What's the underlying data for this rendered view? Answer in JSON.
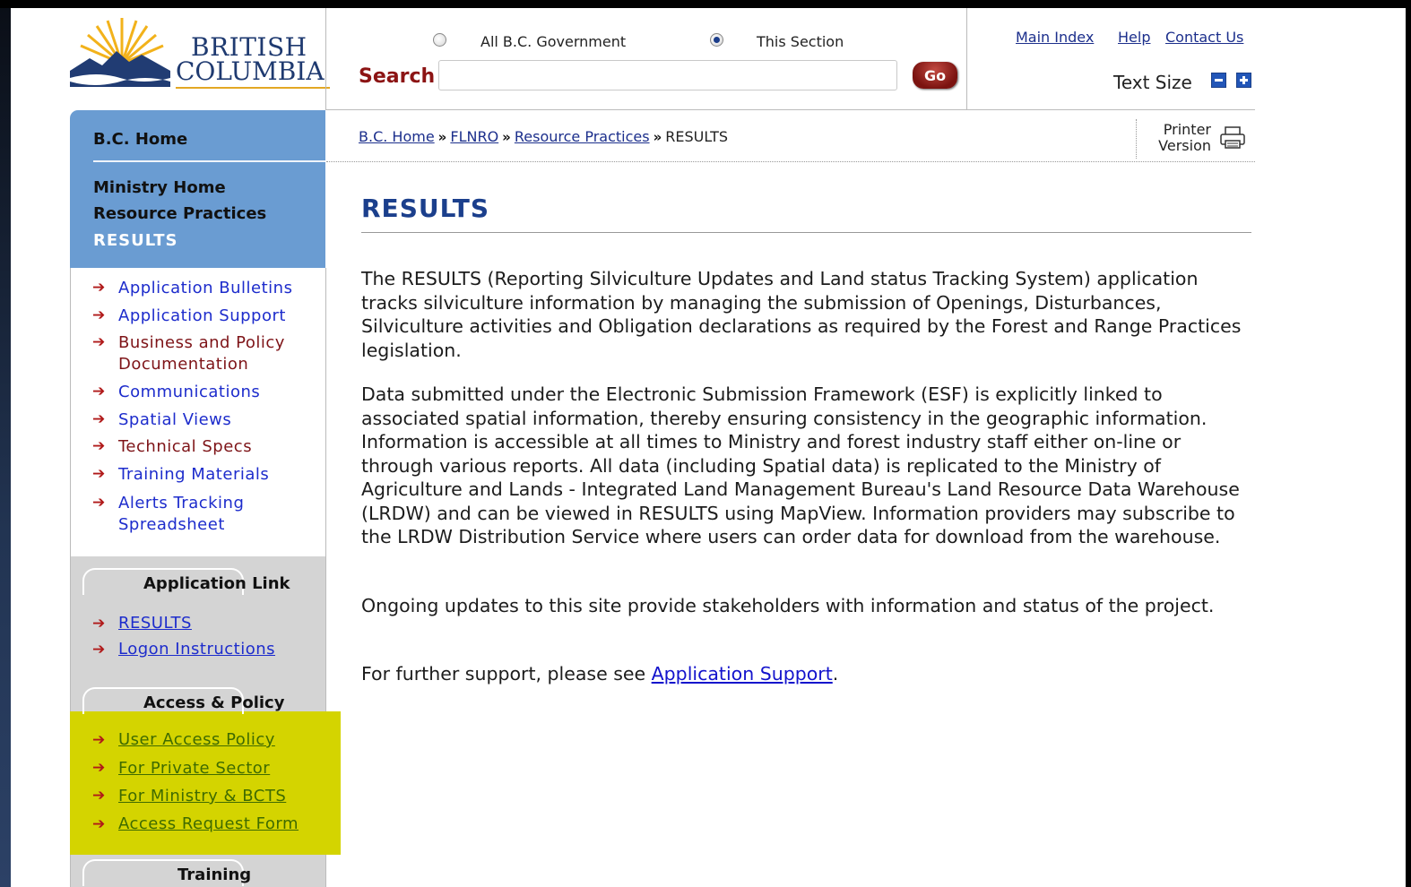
{
  "header": {
    "logo_line1": "BRITISH",
    "logo_line2": "COLUMBIA",
    "scope_options": [
      "All B.C. Government",
      "This Section"
    ],
    "scope_selected": "This Section",
    "search_label": "Search",
    "search_value": "",
    "go_label": "Go",
    "top_links": [
      "Main Index",
      "Help",
      "Contact Us"
    ],
    "text_size_label": "Text Size"
  },
  "nav": {
    "home": "B.C. Home",
    "ministry_home": "Ministry Home",
    "resource_practices": "Resource Practices",
    "current": "RESULTS",
    "links": [
      {
        "label": "Application Bulletins"
      },
      {
        "label": "Application Support"
      },
      {
        "label_line1": "Business and Policy",
        "label_line2": "Documentation"
      },
      {
        "label": "Communications"
      },
      {
        "label": "Spatial Views"
      },
      {
        "label": "Technical Specs"
      },
      {
        "label": "Training Materials"
      },
      {
        "label_line1": "Alerts Tracking",
        "label_line2": "Spreadsheet"
      }
    ],
    "application_link": {
      "title": "Application Link",
      "links": [
        "RESULTS",
        "Logon Instructions"
      ]
    },
    "access_policy": {
      "title": "Access & Policy",
      "links": [
        "User Access Policy",
        "For Private Sector",
        "For Ministry & BCTS",
        "Access Request Form"
      ]
    },
    "training": {
      "title": "Training"
    }
  },
  "breadcrumb": {
    "items": [
      "B.C. Home",
      "FLNRO",
      "Resource Practices"
    ],
    "current": "RESULTS",
    "separator": "»"
  },
  "printer": {
    "line1": "Printer",
    "line2": "Version"
  },
  "main": {
    "title": "RESULTS",
    "para1": "The RESULTS (Reporting Silviculture Updates and Land status Tracking System) application tracks silviculture information by managing the submission of Openings, Disturbances, Silviculture activities and Obligation declarations as required by the Forest and Range Practices legislation.",
    "para2": "Data submitted under the Electronic Submission Framework (ESF) is explicitly linked to associated spatial information, thereby ensuring consistency in the geographic information.  Information is accessible at all times to Ministry and forest industry staff either on-line or through various reports.  All data (including Spatial data) is replicated to the Ministry of Agriculture and Lands - Integrated Land Management Bureau's Land Resource Data Warehouse (LRDW) and can be viewed in RESULTS using MapView.  Information providers may subscribe to the LRDW Distribution Service where users can order data for download from the warehouse.",
    "para3": "Ongoing updates to this site provide stakeholders with information and status of the project.",
    "para4_prefix": "For further support, please see ",
    "para4_link": "Application Support",
    "para4_suffix": "."
  },
  "colors": {
    "nav_blue": "#6a9cd2",
    "title_blue": "#1b3f8c",
    "search_red": "#8c1414",
    "highlight_yellow": "#d4d400"
  }
}
